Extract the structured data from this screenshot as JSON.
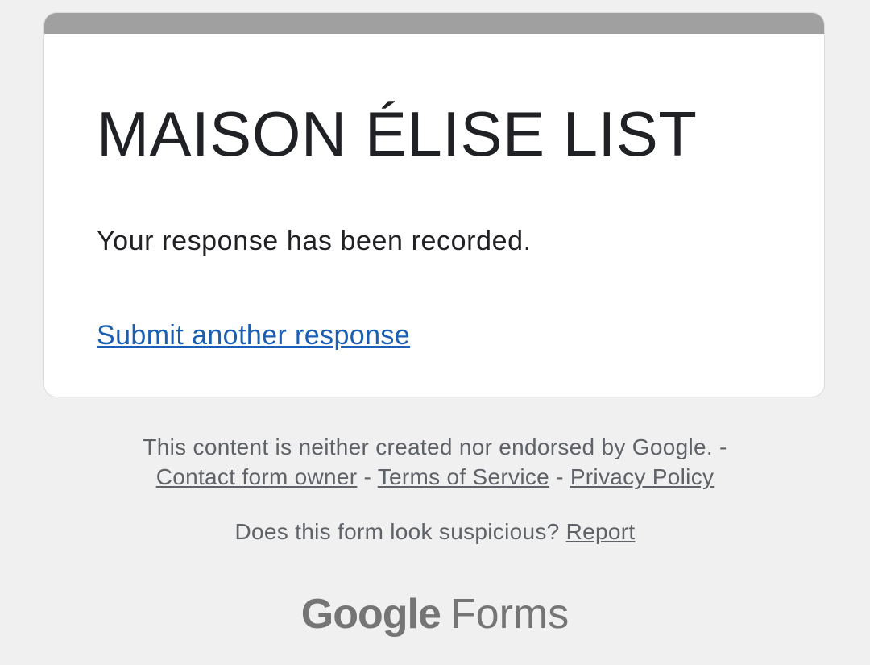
{
  "form": {
    "title": "MAISON ÉLISE LIST",
    "confirmation_message": "Your response has been recorded.",
    "submit_another_label": "Submit another response"
  },
  "footer": {
    "disclaimer": "This content is neither created nor endorsed by Google. -",
    "contact_owner_label": "Contact form owner",
    "separator": "-",
    "terms_label": "Terms of Service",
    "privacy_label": "Privacy Policy",
    "suspicious_question": "Does this form look suspicious?",
    "report_label": "Report"
  },
  "branding": {
    "google": "Google",
    "product": "Forms"
  },
  "colors": {
    "page_background": "#f0f0f0",
    "card_header": "#a0a0a0",
    "link": "#1a5fb4",
    "footer_text": "#5f6368"
  }
}
